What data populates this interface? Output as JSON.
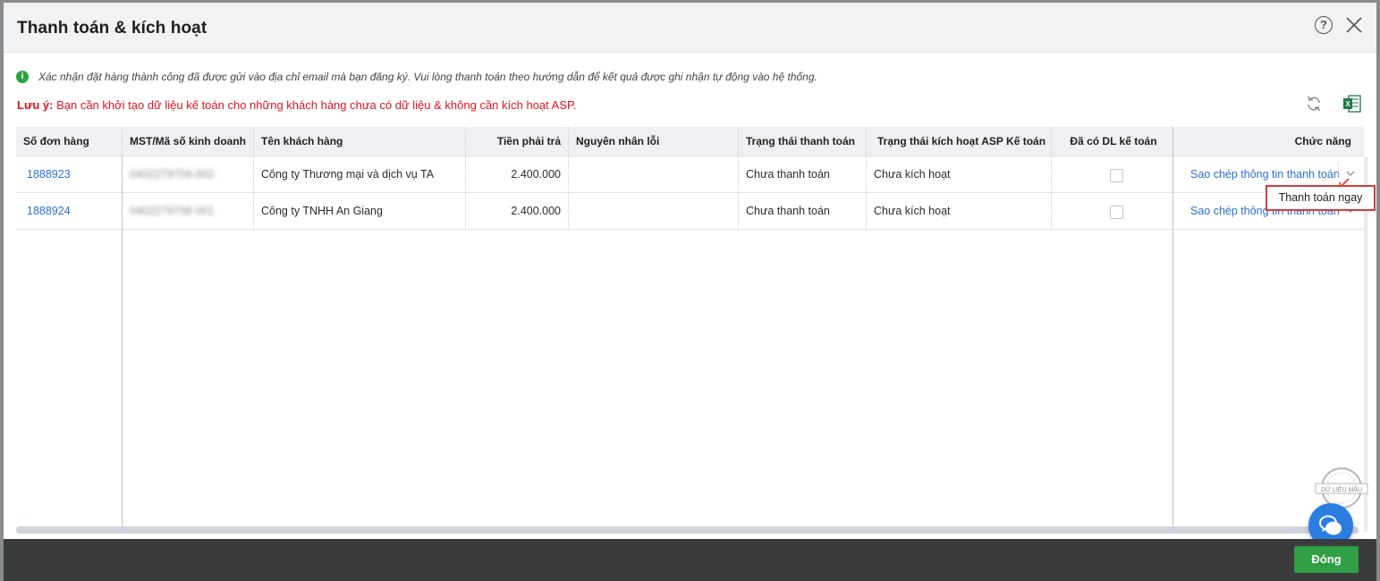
{
  "dialog": {
    "title": "Thanh toán & kích hoạt"
  },
  "header": {
    "help_icon": "help-circle-icon",
    "help_glyph": "?",
    "close_icon": "close-x-icon"
  },
  "messages": {
    "info": "Xác nhận đặt hàng thành công đã được gửi vào địa chỉ email mà bạn đăng ký. Vui lòng thanh toán theo hướng dẫn để kết quả được ghi nhận tự động vào hệ thống.",
    "info_icon": "info-icon",
    "info_glyph": "i",
    "note_label": "Lưu ý:",
    "note_text": " Bạn cần khởi tạo dữ liệu kế toán cho những khách hàng chưa có dữ liệu & không cần kích hoạt ASP."
  },
  "toolbar": {
    "refresh_icon": "refresh-icon",
    "excel_icon": "excel-export-icon"
  },
  "table": {
    "columns": [
      "Số đơn hàng",
      "MST/Mã số kinh doanh",
      "Tên khách hàng",
      "Tiền phải trả",
      "Nguyên nhân lỗi",
      "Trạng thái thanh toán",
      "Trạng thái kích hoạt ASP Kế toán",
      "Đã có DL kế toán",
      "Chức năng"
    ],
    "rows": [
      {
        "order_no": "1888923",
        "tax_code": "0402279756-002",
        "customer": "Công ty Thương mại và dịch vụ TA",
        "amount": "2.400.000",
        "error": "",
        "payment_status": "Chưa thanh toán",
        "asp_status": "Chưa kích hoạt",
        "has_data": false,
        "action": "Sao chép thông tin thanh toán"
      },
      {
        "order_no": "1888924",
        "tax_code": "0402279756-001",
        "customer": "Công ty TNHH An Giang",
        "amount": "2.400.000",
        "error": "",
        "payment_status": "Chưa thanh toán",
        "asp_status": "Chưa kích hoạt",
        "has_data": false,
        "action": "Sao chép thông tin thanh toán"
      }
    ]
  },
  "dropdown": {
    "item": "Thanh toán ngay"
  },
  "watermark": {
    "text": "DỮ LIỆU MẪU"
  },
  "chat": {
    "icon": "chat-bubble-icon"
  },
  "footer": {
    "close_label": "Đóng"
  },
  "colors": {
    "link": "#2b6fd1",
    "warning": "#e0141b",
    "primary_button": "#2f9e44",
    "footer_bg": "#3a3b3d",
    "highlight_border": "#d93a3a"
  }
}
